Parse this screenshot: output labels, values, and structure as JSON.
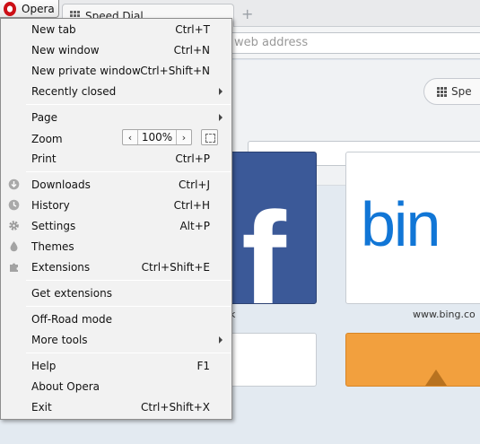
{
  "window": {
    "opera_button": "Opera",
    "tab_title": "Speed Dial",
    "address_placeholder": "web address"
  },
  "speed_dial": {
    "toggle_label": "Spe",
    "tiles": [
      {
        "name": "facebook",
        "caption": "k"
      },
      {
        "name": "bing",
        "logo_text": "bin",
        "caption": "www.bing.co"
      }
    ]
  },
  "menu": {
    "new_tab": {
      "label": "New tab",
      "shortcut": "Ctrl+T"
    },
    "new_window": {
      "label": "New window",
      "shortcut": "Ctrl+N"
    },
    "new_private_window": {
      "label": "New private window",
      "shortcut": "Ctrl+Shift+N"
    },
    "recently_closed": {
      "label": "Recently closed"
    },
    "page": {
      "label": "Page"
    },
    "zoom": {
      "label": "Zoom",
      "value": "100%",
      "minus": "‹",
      "plus": "›"
    },
    "print": {
      "label": "Print",
      "shortcut": "Ctrl+P"
    },
    "downloads": {
      "label": "Downloads",
      "shortcut": "Ctrl+J",
      "icon": "download-icon"
    },
    "history": {
      "label": "History",
      "shortcut": "Ctrl+H",
      "icon": "clock-icon"
    },
    "settings": {
      "label": "Settings",
      "shortcut": "Alt+P",
      "icon": "gear-icon"
    },
    "themes": {
      "label": "Themes",
      "icon": "drop-icon"
    },
    "extensions": {
      "label": "Extensions",
      "shortcut": "Ctrl+Shift+E",
      "icon": "puzzle-icon"
    },
    "get_extensions": {
      "label": "Get extensions"
    },
    "off_road": {
      "label": "Off-Road mode"
    },
    "more_tools": {
      "label": "More tools"
    },
    "help": {
      "label": "Help",
      "shortcut": "F1"
    },
    "about": {
      "label": "About Opera"
    },
    "exit": {
      "label": "Exit",
      "shortcut": "Ctrl+Shift+X"
    }
  },
  "colors": {
    "opera_red": "#cc0f16",
    "facebook_blue": "#3b5998",
    "bing_blue": "#1176d6",
    "orange_tile": "#f2a03e"
  }
}
